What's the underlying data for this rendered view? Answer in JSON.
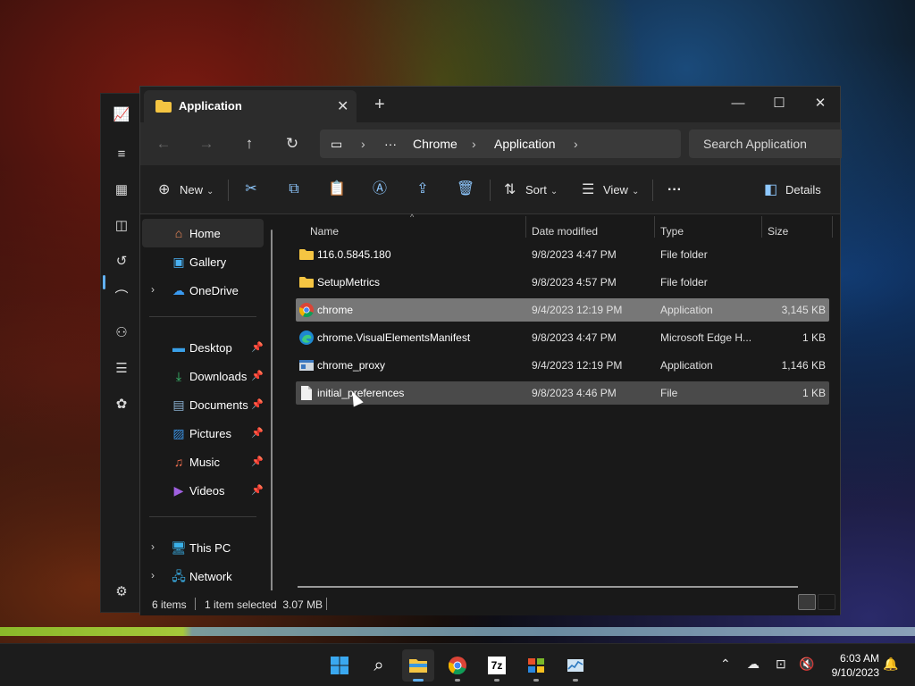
{
  "window": {
    "tab_title": "Application",
    "breadcrumb": [
      "Chrome",
      "Application"
    ],
    "search_placeholder": "Search Application"
  },
  "toolbar": {
    "new_label": "New",
    "sort_label": "Sort",
    "view_label": "View",
    "details_label": "Details",
    "more_label": "···"
  },
  "nav": {
    "home": "Home",
    "gallery": "Gallery",
    "onedrive": "OneDrive",
    "desktop": "Desktop",
    "downloads": "Downloads",
    "documents": "Documents",
    "pictures": "Pictures",
    "music": "Music",
    "videos": "Videos",
    "thispc": "This PC",
    "network": "Network"
  },
  "columns": {
    "name": "Name",
    "date": "Date modified",
    "type": "Type",
    "size": "Size"
  },
  "files": [
    {
      "name": "116.0.5845.180",
      "date": "9/8/2023 4:47 PM",
      "type": "File folder",
      "size": "",
      "icon": "folder-icon"
    },
    {
      "name": "SetupMetrics",
      "date": "9/8/2023 4:57 PM",
      "type": "File folder",
      "size": "",
      "icon": "folder-icon"
    },
    {
      "name": "chrome",
      "date": "9/4/2023 12:19 PM",
      "type": "Application",
      "size": "3,145 KB",
      "icon": "chrome-icon"
    },
    {
      "name": "chrome.VisualElementsManifest",
      "date": "9/8/2023 4:47 PM",
      "type": "Microsoft Edge H...",
      "size": "1 KB",
      "icon": "edge-icon"
    },
    {
      "name": "chrome_proxy",
      "date": "9/4/2023 12:19 PM",
      "type": "Application",
      "size": "1,146 KB",
      "icon": "app-icon"
    },
    {
      "name": "initial_preferences",
      "date": "9/8/2023 4:46 PM",
      "type": "File",
      "size": "1 KB",
      "icon": "file-icon"
    }
  ],
  "status": {
    "items": "6 items",
    "selected": "1 item selected  3.07 MB"
  },
  "taskbar": {
    "time": "6:03 AM",
    "date": "9/10/2023"
  },
  "colors": {
    "accent": "#60b0f0",
    "selected_row": "#777777",
    "folder": "#f5c542"
  }
}
